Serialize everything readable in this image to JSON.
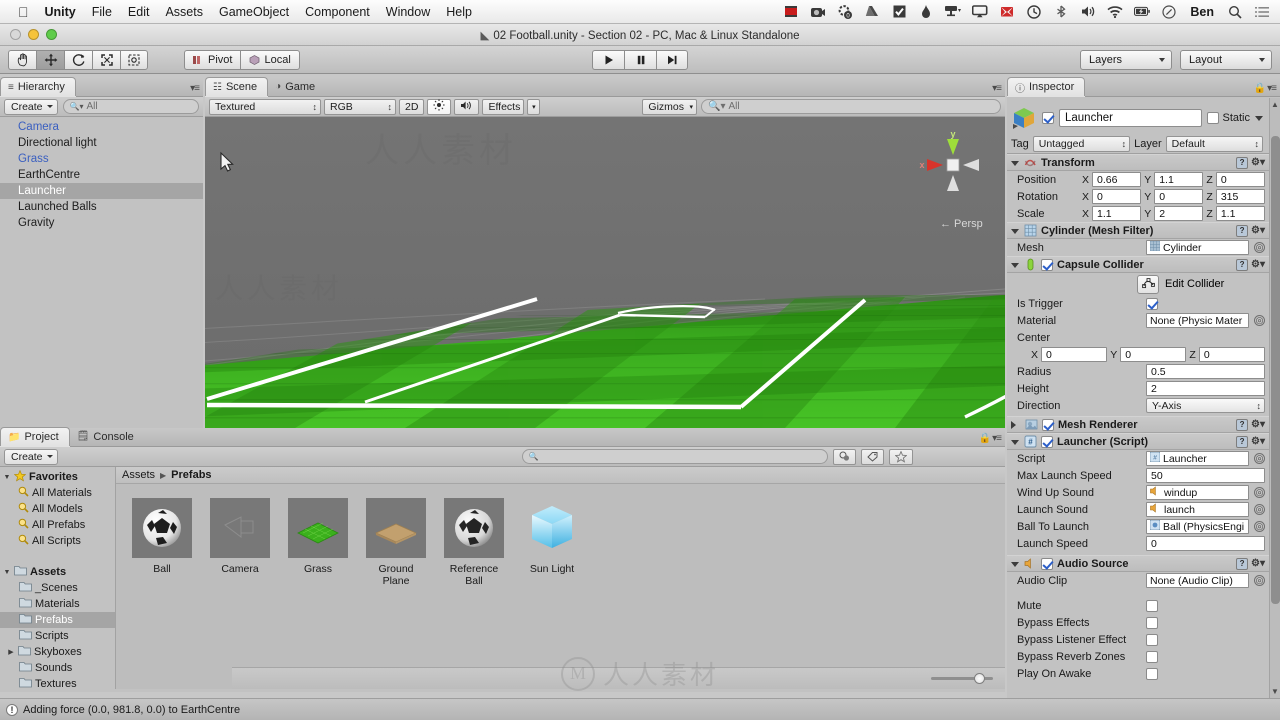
{
  "macbar": {
    "apple_icon": "apple-icon",
    "menus": [
      "Unity",
      "File",
      "Edit",
      "Assets",
      "GameObject",
      "Component",
      "Window",
      "Help"
    ],
    "status_icons": [
      "screen-recorder-icon",
      "camera-icon",
      "settings-badge-icon",
      "drive-icon",
      "checkbox-app-icon",
      "flame-icon",
      "display-icon",
      "airplay-icon",
      "dropbox-x-icon",
      "time-machine-icon",
      "bluetooth-icon",
      "volume-icon",
      "wifi-icon",
      "battery-charging-icon",
      "clock-icon"
    ],
    "user": "Ben",
    "search_icon": "search-icon",
    "list_icon": "notification-center-icon"
  },
  "titlebar": {
    "title": "02 Football.unity - Section 02 - PC, Mac & Linux Standalone",
    "unity_icon": "unity-logo-icon"
  },
  "toolbar": {
    "tools": [
      {
        "name": "hand-tool",
        "icon": "hand-icon",
        "active": false
      },
      {
        "name": "move-tool",
        "icon": "move-icon",
        "active": true
      },
      {
        "name": "rotate-tool",
        "icon": "rotate-icon",
        "active": false
      },
      {
        "name": "scale-tool",
        "icon": "scale-icon",
        "active": false
      },
      {
        "name": "rect-tool",
        "icon": "rect-transform-icon",
        "active": false
      }
    ],
    "pivot_label": "Pivot",
    "pivot_icon": "pivot-icon",
    "local_label": "Local",
    "local_icon": "local-space-icon",
    "play_label": "play-icon",
    "pause_label": "pause-icon",
    "step_label": "step-icon",
    "layers_label": "Layers",
    "layout_label": "Layout"
  },
  "hierarchy": {
    "tab_label": "Hierarchy",
    "tab_icon": "hierarchy-icon",
    "create_label": "Create",
    "search_placeholder": "All",
    "search_icon": "search-icon",
    "items": [
      {
        "label": "Camera",
        "style": "prefab"
      },
      {
        "label": "Directional light",
        "style": "normal"
      },
      {
        "label": "Grass",
        "style": "prefab"
      },
      {
        "label": "EarthCentre",
        "style": "normal"
      },
      {
        "label": "Launcher",
        "style": "selected"
      },
      {
        "label": "Launched Balls",
        "style": "normal"
      },
      {
        "label": "Gravity",
        "style": "normal"
      }
    ]
  },
  "scene": {
    "tabs": [
      {
        "label": "Scene",
        "icon": "scene-icon",
        "active": true
      },
      {
        "label": "Game",
        "icon": "game-icon",
        "active": false
      }
    ],
    "draw_mode": "Textured",
    "color_mode": "RGB",
    "two_d_label": "2D",
    "lighting_icon": "lighting-icon",
    "audio_icon": "audio-icon",
    "effects_label": "Effects",
    "gizmos_label": "Gizmos",
    "search_placeholder": "All",
    "axis_gizmo": {
      "y_label": "y",
      "x_label": "x",
      "perspective_label": "Persp",
      "x_color": "#d8342a",
      "y_color": "#9ede3a",
      "z_color": "#e8e8e8"
    },
    "background_color": "#6f6f6f",
    "grass_color": "#3fb21e",
    "line_color": "#ffffff"
  },
  "inspector": {
    "tab_label": "Inspector",
    "tab_icon": "inspector-icon",
    "lock_icon": "lock-icon",
    "object_name": "Launcher",
    "object_enabled": true,
    "static_label": "Static",
    "tag_label": "Tag",
    "tag_value": "Untagged",
    "layer_label": "Layer",
    "layer_value": "Default",
    "components": [
      {
        "name": "Transform",
        "icon": "transform-icon",
        "expanded": true,
        "has_checkbox": false,
        "rows": [
          {
            "type": "vector3",
            "label": "Position",
            "x": "0.66",
            "y": "1.1",
            "z": "0"
          },
          {
            "type": "vector3",
            "label": "Rotation",
            "x": "0",
            "y": "0",
            "z": "315"
          },
          {
            "type": "vector3",
            "label": "Scale",
            "x": "1.1",
            "y": "2",
            "z": "1.1"
          }
        ]
      },
      {
        "name": "Cylinder (Mesh Filter)",
        "icon": "mesh-filter-icon",
        "expanded": true,
        "has_checkbox": false,
        "rows": [
          {
            "type": "object",
            "label": "Mesh",
            "value": "Cylinder",
            "value_icon": "mesh-icon"
          }
        ]
      },
      {
        "name": "Capsule Collider",
        "icon": "capsule-collider-icon",
        "expanded": true,
        "has_checkbox": true,
        "checked": true,
        "rows": [
          {
            "type": "editcollider",
            "label": "Edit Collider",
            "icon": "edit-collider-icon"
          },
          {
            "type": "checkbox",
            "label": "Is Trigger",
            "checked": true
          },
          {
            "type": "object",
            "label": "Material",
            "value": "None (Physic Mater"
          },
          {
            "type": "header",
            "label": "Center"
          },
          {
            "type": "vector3",
            "label": "",
            "x": "0",
            "y": "0",
            "z": "0"
          },
          {
            "type": "text",
            "label": "Radius",
            "value": "0.5"
          },
          {
            "type": "text",
            "label": "Height",
            "value": "2"
          },
          {
            "type": "popup",
            "label": "Direction",
            "value": "Y-Axis"
          }
        ]
      },
      {
        "name": "Mesh Renderer",
        "icon": "mesh-renderer-icon",
        "expanded": false,
        "has_checkbox": true,
        "checked": true,
        "rows": []
      },
      {
        "name": "Launcher (Script)",
        "icon": "script-icon",
        "expanded": true,
        "has_checkbox": true,
        "checked": true,
        "rows": [
          {
            "type": "object",
            "label": "Script",
            "value": "Launcher",
            "value_icon": "script-icon"
          },
          {
            "type": "text",
            "label": "Max Launch Speed",
            "value": "50"
          },
          {
            "type": "object",
            "label": "Wind Up Sound",
            "value": "windup",
            "value_icon": "audio-clip-icon"
          },
          {
            "type": "object",
            "label": "Launch Sound",
            "value": "launch",
            "value_icon": "audio-clip-icon"
          },
          {
            "type": "object",
            "label": "Ball To Launch",
            "value": "Ball (PhysicsEngi",
            "value_icon": "prefab-icon"
          },
          {
            "type": "text",
            "label": "Launch Speed",
            "value": "0"
          }
        ]
      },
      {
        "name": "Audio Source",
        "icon": "audio-source-icon",
        "expanded": true,
        "has_checkbox": true,
        "checked": true,
        "rows": [
          {
            "type": "object",
            "label": "Audio Clip",
            "value": "None (Audio Clip)"
          },
          {
            "type": "spacer"
          },
          {
            "type": "checkbox",
            "label": "Mute",
            "checked": false
          },
          {
            "type": "checkbox",
            "label": "Bypass Effects",
            "checked": false
          },
          {
            "type": "checkbox",
            "label": "Bypass Listener Effect",
            "checked": false
          },
          {
            "type": "checkbox",
            "label": "Bypass Reverb Zones",
            "checked": false
          },
          {
            "type": "checkbox",
            "label": "Play On Awake",
            "checked": false
          }
        ]
      }
    ]
  },
  "project": {
    "tabs": [
      {
        "label": "Project",
        "icon": "project-icon",
        "active": true
      },
      {
        "label": "Console",
        "icon": "console-icon",
        "active": false
      }
    ],
    "create_label": "Create",
    "search_placeholder": "",
    "search_icon": "search-icon",
    "filter_icons": [
      "filter-by-type-icon",
      "filter-by-label-icon",
      "favorite-star-icon"
    ],
    "tree": [
      {
        "label": "Favorites",
        "depth": 0,
        "arrow": "down",
        "icon": "star-icon",
        "bold": true,
        "selected": false
      },
      {
        "label": "All Materials",
        "depth": 1,
        "arrow": "",
        "icon": "search-icon",
        "bold": false,
        "selected": false
      },
      {
        "label": "All Models",
        "depth": 1,
        "arrow": "",
        "icon": "search-icon",
        "bold": false,
        "selected": false
      },
      {
        "label": "All Prefabs",
        "depth": 1,
        "arrow": "",
        "icon": "search-icon",
        "bold": false,
        "selected": false
      },
      {
        "label": "All Scripts",
        "depth": 1,
        "arrow": "",
        "icon": "search-icon",
        "bold": false,
        "selected": false
      },
      {
        "label": "",
        "depth": 0,
        "arrow": "",
        "icon": "",
        "bold": false,
        "selected": false
      },
      {
        "label": "Assets",
        "depth": 0,
        "arrow": "down",
        "icon": "folder-icon",
        "bold": true,
        "selected": false
      },
      {
        "label": "_Scenes",
        "depth": 1,
        "arrow": "",
        "icon": "folder-icon",
        "bold": false,
        "selected": false
      },
      {
        "label": "Materials",
        "depth": 1,
        "arrow": "",
        "icon": "folder-icon",
        "bold": false,
        "selected": false
      },
      {
        "label": "Prefabs",
        "depth": 1,
        "arrow": "",
        "icon": "folder-icon",
        "bold": false,
        "selected": true
      },
      {
        "label": "Scripts",
        "depth": 1,
        "arrow": "",
        "icon": "folder-icon",
        "bold": false,
        "selected": false
      },
      {
        "label": "Skyboxes",
        "depth": 1,
        "arrow": "right",
        "icon": "folder-icon",
        "bold": false,
        "selected": false
      },
      {
        "label": "Sounds",
        "depth": 1,
        "arrow": "",
        "icon": "folder-icon",
        "bold": false,
        "selected": false
      },
      {
        "label": "Textures",
        "depth": 1,
        "arrow": "",
        "icon": "folder-icon",
        "bold": false,
        "selected": false
      }
    ],
    "breadcrumb": [
      "Assets",
      "Prefabs"
    ],
    "assets": [
      {
        "label": "Ball",
        "thumb": "soccer-ball-thumb"
      },
      {
        "label": "Camera",
        "thumb": "camera-thumb"
      },
      {
        "label": "Grass",
        "thumb": "grass-plane-thumb"
      },
      {
        "label": "Ground Plane",
        "thumb": "ground-plane-thumb"
      },
      {
        "label": "Reference Ball",
        "thumb": "soccer-ball-thumb"
      },
      {
        "label": "Sun Light",
        "thumb": "light-cube-thumb"
      }
    ],
    "zoom_slider_value": 72
  },
  "statusbar": {
    "icon": "info-icon",
    "message": "Adding force (0.0, 981.8, 0.0) to EarthCentre"
  },
  "watermark": {
    "logo_letter": "M",
    "text": "人人素材"
  }
}
